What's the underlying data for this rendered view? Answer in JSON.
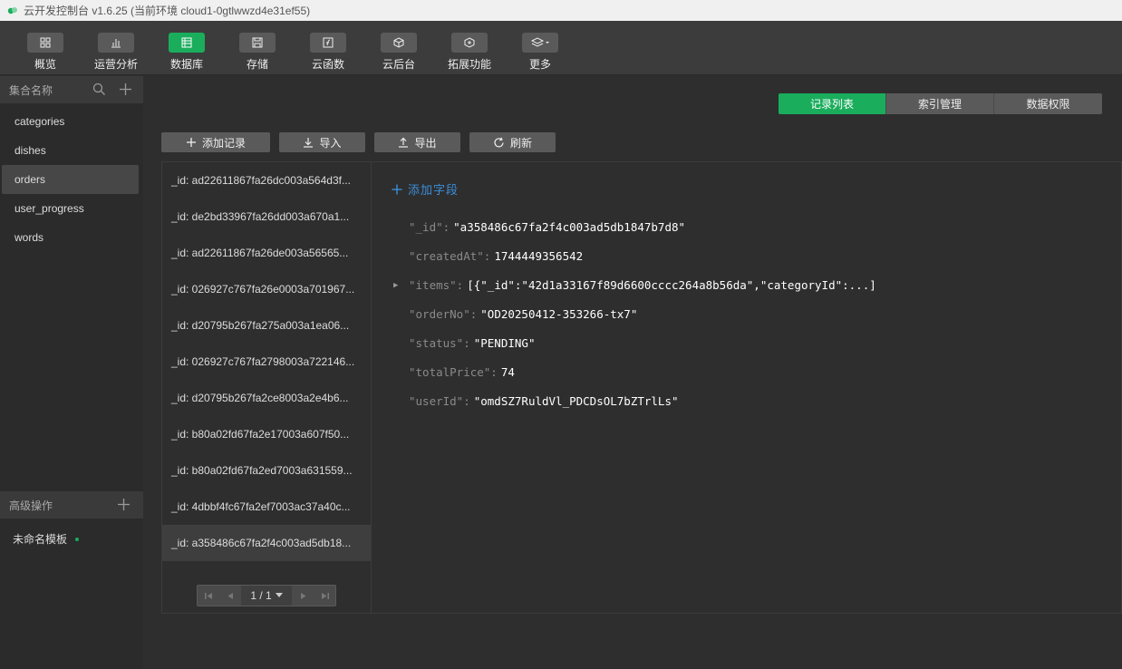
{
  "window": {
    "title": "云开发控制台 v1.6.25 (当前环境 cloud1-0gtlwwzd4e31ef55)"
  },
  "toolbar": {
    "items": [
      {
        "label": "概览",
        "icon": "grid-icon",
        "active": false
      },
      {
        "label": "运营分析",
        "icon": "bar-chart-icon",
        "active": false
      },
      {
        "label": "数据库",
        "icon": "database-icon",
        "active": true
      },
      {
        "label": "存储",
        "icon": "save-icon",
        "active": false
      },
      {
        "label": "云函数",
        "icon": "function-icon",
        "active": false
      },
      {
        "label": "云后台",
        "icon": "cube-icon",
        "active": false
      },
      {
        "label": "拓展功能",
        "icon": "extension-icon",
        "active": false
      },
      {
        "label": "更多",
        "icon": "layers-icon",
        "active": false
      }
    ]
  },
  "sidebar": {
    "header": "集合名称",
    "collections": [
      "categories",
      "dishes",
      "orders",
      "user_progress",
      "words"
    ],
    "selected_collection": "orders",
    "advanced_header": "高级操作",
    "template": "未命名模板"
  },
  "tabs": [
    "记录列表",
    "索引管理",
    "数据权限"
  ],
  "active_tab": "记录列表",
  "actions": {
    "add": "添加记录",
    "import": "导入",
    "export": "导出",
    "refresh": "刷新"
  },
  "records": [
    "_id: ad22611867fa26dc003a564d3f...",
    "_id: de2bd33967fa26dd003a670a1...",
    "_id: ad22611867fa26de003a56565...",
    "_id: 026927c767fa26e0003a701967...",
    "_id: d20795b267fa275a003a1ea06...",
    "_id: 026927c767fa2798003a722146...",
    "_id: d20795b267fa2ce8003a2e4b6...",
    "_id: b80a02fd67fa2e17003a607f50...",
    "_id: b80a02fd67fa2ed7003a631559...",
    "_id: 4dbbf4fc67fa2ef7003ac37a40c...",
    "_id: a358486c67fa2f4c003ad5db18..."
  ],
  "selected_record_index": 10,
  "pager": {
    "text": "1 / 1"
  },
  "document": {
    "add_field": "添加字段",
    "fields": [
      {
        "key": "\"_id\":",
        "value": "\"a358486c67fa2f4c003ad5db1847b7d8\"",
        "expandable": false
      },
      {
        "key": "\"createdAt\":",
        "value": "1744449356542",
        "expandable": false
      },
      {
        "key": "\"items\":",
        "value": "[{\"_id\":\"42d1a33167f89d6600cccc264a8b56da\",\"categoryId\":...]",
        "expandable": true
      },
      {
        "key": "\"orderNo\":",
        "value": "\"OD20250412-353266-tx7\"",
        "expandable": false
      },
      {
        "key": "\"status\":",
        "value": "\"PENDING\"",
        "expandable": false
      },
      {
        "key": "\"totalPrice\":",
        "value": "74",
        "expandable": false
      },
      {
        "key": "\"userId\":",
        "value": "\"omdSZ7RuldVl_PDCDsOL7bZTrlLs\"",
        "expandable": false
      }
    ]
  },
  "colors": {
    "accent": "#1aad5c",
    "link": "#3b8ed8"
  }
}
